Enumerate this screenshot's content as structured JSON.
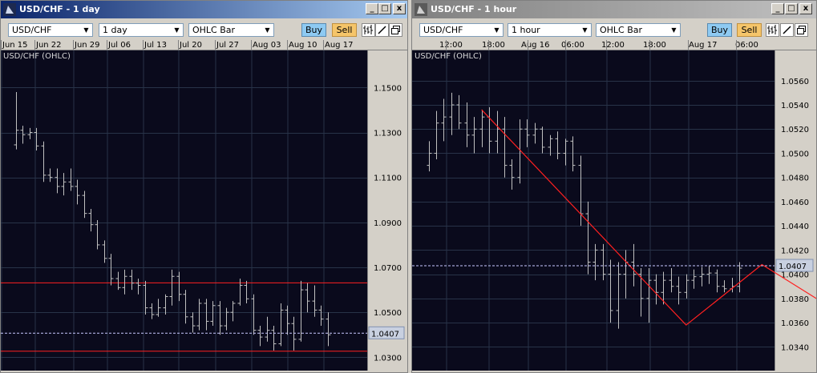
{
  "colors": {
    "background": "#0a0a1c",
    "grid": "#283348",
    "bars": "#c0c0c0",
    "price_line": "#c8c8ff",
    "trendline": "#ff2020",
    "axis_panel": "#d4d0c8",
    "buy": "#8ecaf2",
    "sell": "#f5c56a"
  },
  "windows": [
    {
      "title": "USD/CHF - 1 day",
      "symbol": "USD/CHF",
      "interval": "1 day",
      "chart_type": "OHLC Bar",
      "buy_label": "Buy",
      "sell_label": "Sell",
      "legend": "USD/CHF (OHLC)",
      "current_price": "1.0407",
      "controls": {
        "minimize": "_",
        "maximize": "□",
        "close": "x"
      }
    },
    {
      "title": "USD/CHF - 1 hour",
      "symbol": "USD/CHF",
      "interval": "1 hour",
      "chart_type": "OHLC Bar",
      "buy_label": "Buy",
      "sell_label": "Sell",
      "legend": "USD/CHF (OHLC)",
      "current_price": "1.0407",
      "controls": {
        "minimize": "_",
        "maximize": "□",
        "close": "x"
      }
    }
  ],
  "chart_data": [
    {
      "type": "ohlc",
      "title": "USD/CHF (OHLC)",
      "x_tick_labels": [
        "Jun 15",
        "Jun 22",
        "Jun 29",
        "Jul 06",
        "Jul 13",
        "Jul 20",
        "Jul 27",
        "Aug 03",
        "Aug 10",
        "Aug 17"
      ],
      "y_tick_labels": [
        "1.1500",
        "1.1300",
        "1.1100",
        "1.0900",
        "1.0700",
        "1.0500",
        "1.0300"
      ],
      "ylim": [
        1.0255,
        1.1665
      ],
      "current_price": 1.0407,
      "horizontal_lines": [
        1.0631,
        1.0327
      ],
      "ohlc": [
        [
          1.1245,
          1.148,
          1.1225,
          1.131
        ],
        [
          1.131,
          1.133,
          1.125,
          1.129
        ],
        [
          1.129,
          1.132,
          1.127,
          1.13
        ],
        [
          1.13,
          1.132,
          1.122,
          1.124
        ],
        [
          1.124,
          1.126,
          1.108,
          1.111
        ],
        [
          1.111,
          1.114,
          1.108,
          1.11
        ],
        [
          1.11,
          1.114,
          1.103,
          1.106
        ],
        [
          1.106,
          1.112,
          1.102,
          1.108
        ],
        [
          1.108,
          1.114,
          1.104,
          1.106
        ],
        [
          1.106,
          1.109,
          1.098,
          1.102
        ],
        [
          1.102,
          1.104,
          1.092,
          1.094
        ],
        [
          1.094,
          1.096,
          1.086,
          1.089
        ],
        [
          1.089,
          1.091,
          1.078,
          1.08
        ],
        [
          1.08,
          1.082,
          1.072,
          1.074
        ],
        [
          1.074,
          1.076,
          1.062,
          1.065
        ],
        [
          1.065,
          1.068,
          1.06,
          1.061
        ],
        [
          1.061,
          1.069,
          1.058,
          1.066
        ],
        [
          1.066,
          1.069,
          1.06,
          1.063
        ],
        [
          1.063,
          1.065,
          1.058,
          1.062
        ],
        [
          1.062,
          1.064,
          1.049,
          1.052
        ],
        [
          1.052,
          1.054,
          1.047,
          1.049
        ],
        [
          1.049,
          1.056,
          1.048,
          1.052
        ],
        [
          1.052,
          1.058,
          1.049,
          1.057
        ],
        [
          1.057,
          1.069,
          1.053,
          1.066
        ],
        [
          1.066,
          1.068,
          1.055,
          1.058
        ],
        [
          1.058,
          1.06,
          1.045,
          1.048
        ],
        [
          1.048,
          1.05,
          1.041,
          1.044
        ],
        [
          1.044,
          1.056,
          1.042,
          1.054
        ],
        [
          1.054,
          1.056,
          1.042,
          1.046
        ],
        [
          1.046,
          1.055,
          1.044,
          1.053
        ],
        [
          1.053,
          1.055,
          1.04,
          1.044
        ],
        [
          1.044,
          1.052,
          1.042,
          1.05
        ],
        [
          1.05,
          1.055,
          1.046,
          1.054
        ],
        [
          1.054,
          1.065,
          1.053,
          1.062
        ],
        [
          1.062,
          1.064,
          1.054,
          1.056
        ],
        [
          1.056,
          1.058,
          1.04,
          1.042
        ],
        [
          1.042,
          1.044,
          1.035,
          1.039
        ],
        [
          1.039,
          1.048,
          1.037,
          1.042
        ],
        [
          1.042,
          1.044,
          1.033,
          1.036
        ],
        [
          1.036,
          1.054,
          1.035,
          1.051
        ],
        [
          1.051,
          1.053,
          1.04,
          1.045
        ],
        [
          1.045,
          1.048,
          1.033,
          1.038
        ],
        [
          1.038,
          1.064,
          1.037,
          1.06
        ],
        [
          1.06,
          1.063,
          1.05,
          1.055
        ],
        [
          1.055,
          1.062,
          1.048,
          1.051
        ],
        [
          1.051,
          1.053,
          1.044,
          1.047
        ],
        [
          1.047,
          1.05,
          1.035,
          1.04
        ]
      ]
    },
    {
      "type": "ohlc",
      "title": "USD/CHF (OHLC)",
      "x_tick_labels": [
        "12:00",
        "18:00",
        "Aug 16",
        "06:00",
        "12:00",
        "18:00",
        "Aug 17",
        "06:00"
      ],
      "y_tick_labels": [
        "1.0560",
        "1.0540",
        "1.0520",
        "1.0500",
        "1.0480",
        "1.0460",
        "1.0440",
        "1.0420",
        "1.0400",
        "1.0380",
        "1.0360",
        "1.0340"
      ],
      "ylim": [
        1.0323,
        1.0585
      ],
      "current_price": 1.0407,
      "trendline": [
        [
          7,
          1.0536
        ],
        [
          34,
          1.0358
        ],
        [
          44,
          1.0408
        ],
        [
          55,
          1.0365
        ]
      ],
      "ohlc": [
        [
          1.049,
          1.051,
          1.0485,
          1.05
        ],
        [
          1.05,
          1.0535,
          1.0495,
          1.0525
        ],
        [
          1.0525,
          1.0545,
          1.051,
          1.053
        ],
        [
          1.053,
          1.055,
          1.0515,
          1.054
        ],
        [
          1.054,
          1.0548,
          1.052,
          1.0525
        ],
        [
          1.0525,
          1.0542,
          1.0505,
          1.0515
        ],
        [
          1.0515,
          1.053,
          1.05,
          1.052
        ],
        [
          1.052,
          1.0536,
          1.0505,
          1.053
        ],
        [
          1.053,
          1.0538,
          1.05,
          1.051
        ],
        [
          1.051,
          1.0535,
          1.05,
          1.052
        ],
        [
          1.052,
          1.053,
          1.048,
          1.049
        ],
        [
          1.049,
          1.0495,
          1.047,
          1.048
        ],
        [
          1.048,
          1.0528,
          1.0475,
          1.052
        ],
        [
          1.052,
          1.0528,
          1.0505,
          1.0515
        ],
        [
          1.0515,
          1.0525,
          1.0508,
          1.052
        ],
        [
          1.052,
          1.0522,
          1.05,
          1.0505
        ],
        [
          1.0505,
          1.0515,
          1.0498,
          1.0512
        ],
        [
          1.0512,
          1.0518,
          1.0495,
          1.05
        ],
        [
          1.05,
          1.0512,
          1.049,
          1.051
        ],
        [
          1.051,
          1.0514,
          1.0485,
          1.049
        ],
        [
          1.049,
          1.0498,
          1.044,
          1.045
        ],
        [
          1.045,
          1.046,
          1.04,
          1.041
        ],
        [
          1.041,
          1.0425,
          1.0395,
          1.042
        ],
        [
          1.042,
          1.0425,
          1.0395,
          1.04
        ],
        [
          1.04,
          1.0412,
          1.036,
          1.037
        ],
        [
          1.037,
          1.041,
          1.0355,
          1.04
        ],
        [
          1.04,
          1.042,
          1.038,
          1.041
        ],
        [
          1.041,
          1.0425,
          1.039,
          1.04
        ],
        [
          1.04,
          1.0405,
          1.0365,
          1.038
        ],
        [
          1.038,
          1.0405,
          1.036,
          1.0395
        ],
        [
          1.0395,
          1.04,
          1.0375,
          1.0385
        ],
        [
          1.0385,
          1.0402,
          1.0375,
          1.0395
        ],
        [
          1.0395,
          1.0405,
          1.0385,
          1.039
        ],
        [
          1.039,
          1.0398,
          1.0375,
          1.0385
        ],
        [
          1.0385,
          1.04,
          1.038,
          1.0395
        ],
        [
          1.0395,
          1.0404,
          1.0388,
          1.0398
        ],
        [
          1.0398,
          1.0406,
          1.039,
          1.04
        ],
        [
          1.04,
          1.0407,
          1.0392,
          1.0401
        ],
        [
          1.0401,
          1.0404,
          1.0385,
          1.039
        ],
        [
          1.039,
          1.0395,
          1.0385,
          1.0388
        ],
        [
          1.0388,
          1.0397,
          1.0385,
          1.039
        ],
        [
          1.039,
          1.041,
          1.0385,
          1.0405
        ]
      ]
    }
  ]
}
